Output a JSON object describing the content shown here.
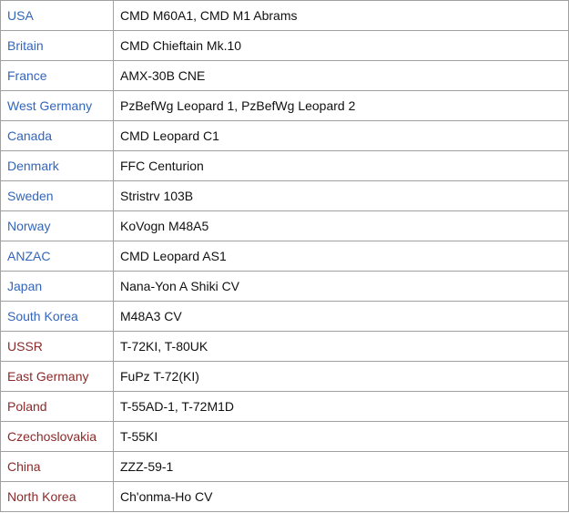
{
  "colors": {
    "nato": "#3366bb",
    "pact": "#8b2a2a",
    "text": "#111111",
    "border": "#a0a0a0"
  },
  "rows": [
    {
      "country": "USA",
      "vehicle": "CMD M60A1, CMD M1 Abrams",
      "side": "nato"
    },
    {
      "country": "Britain",
      "vehicle": "CMD Chieftain Mk.10",
      "side": "nato"
    },
    {
      "country": "France",
      "vehicle": "AMX-30B CNE",
      "side": "nato"
    },
    {
      "country": "West Germany",
      "vehicle": "PzBefWg Leopard 1, PzBefWg Leopard 2",
      "side": "nato"
    },
    {
      "country": "Canada",
      "vehicle": "CMD Leopard C1",
      "side": "nato"
    },
    {
      "country": "Denmark",
      "vehicle": "FFC Centurion",
      "side": "nato"
    },
    {
      "country": "Sweden",
      "vehicle": "Stristrv 103B",
      "side": "nato"
    },
    {
      "country": "Norway",
      "vehicle": "KoVogn M48A5",
      "side": "nato"
    },
    {
      "country": "ANZAC",
      "vehicle": "CMD Leopard AS1",
      "side": "nato"
    },
    {
      "country": "Japan",
      "vehicle": "Nana-Yon A Shiki CV",
      "side": "nato"
    },
    {
      "country": "South Korea",
      "vehicle": "M48A3 CV",
      "side": "nato"
    },
    {
      "country": "USSR",
      "vehicle": "T-72KI, T-80UK",
      "side": "pact"
    },
    {
      "country": "East Germany",
      "vehicle": "FuPz T-72(KI)",
      "side": "pact"
    },
    {
      "country": "Poland",
      "vehicle": "T-55AD-1, T-72M1D",
      "side": "pact"
    },
    {
      "country": "Czechoslovakia",
      "vehicle": "T-55KI",
      "side": "pact"
    },
    {
      "country": "China",
      "vehicle": "ZZZ-59-1",
      "side": "pact"
    },
    {
      "country": "North Korea",
      "vehicle": "Ch'onma-Ho CV",
      "side": "pact"
    }
  ]
}
